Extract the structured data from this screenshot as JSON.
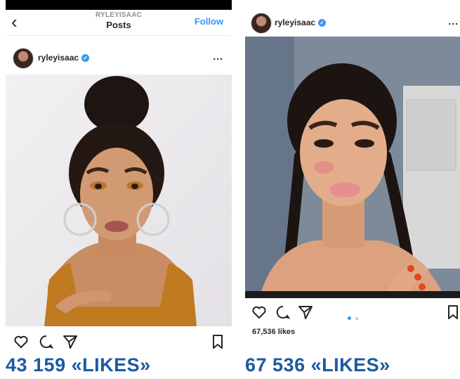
{
  "left_post": {
    "nav": {
      "back_icon": "chevron-left-icon",
      "username": "RYLEYISAAC",
      "title": "Posts",
      "follow_label": "Follow"
    },
    "author": {
      "username": "ryleyisaac",
      "verified": true,
      "more_label": "..."
    },
    "actions": [
      "heart-icon",
      "comment-icon",
      "share-icon",
      "bookmark-icon"
    ],
    "likes_caption": "43 159 «LIKES»"
  },
  "right_post": {
    "author": {
      "username": "ryleyisaac",
      "verified": true,
      "more_label": "..."
    },
    "actions": [
      "heart-icon",
      "comment-icon",
      "share-icon",
      "bookmark-icon"
    ],
    "carousel": {
      "slides": 2,
      "active": 1
    },
    "likes_text": "67,536 likes",
    "likes_caption": "67 536 «LIKES»"
  },
  "colors": {
    "accent_blue": "#3897f0",
    "caption_blue": "#1b5aa3",
    "text": "#262626"
  }
}
